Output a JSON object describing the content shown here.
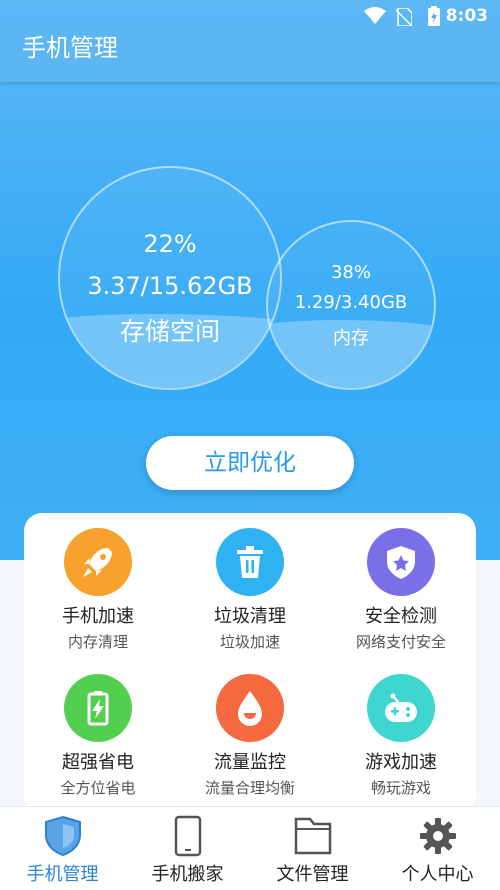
{
  "status": {
    "time": "8:03"
  },
  "app": {
    "title": "手机管理"
  },
  "storage": {
    "percent": "22%",
    "usage": "3.37/15.62GB",
    "label": "存储空间"
  },
  "memory": {
    "percent": "38%",
    "usage": "1.29/3.40GB",
    "label": "内存"
  },
  "optimize": {
    "label": "立即优化"
  },
  "tiles": [
    {
      "title": "手机加速",
      "sub": "内存清理",
      "icon": "rocket-icon",
      "color": "#f7a22c"
    },
    {
      "title": "垃圾清理",
      "sub": "垃圾加速",
      "icon": "trash-icon",
      "color": "#2fb2f2"
    },
    {
      "title": "安全检测",
      "sub": "网络支付安全",
      "icon": "shield-star-icon",
      "color": "#7b6fe8"
    },
    {
      "title": "超强省电",
      "sub": "全方位省电",
      "icon": "battery-icon",
      "color": "#52cf4f"
    },
    {
      "title": "流量监控",
      "sub": "流量合理均衡",
      "icon": "drop-icon",
      "color": "#f5693e"
    },
    {
      "title": "游戏加速",
      "sub": "畅玩游戏",
      "icon": "gamepad-icon",
      "color": "#3ed6cf"
    }
  ],
  "nav": [
    {
      "label": "手机管理",
      "icon": "shield-icon",
      "active": true
    },
    {
      "label": "手机搬家",
      "icon": "phone-icon",
      "active": false
    },
    {
      "label": "文件管理",
      "icon": "folder-icon",
      "active": false
    },
    {
      "label": "个人中心",
      "icon": "gear-icon",
      "active": false
    }
  ],
  "colors": {
    "primary": "#33a9f6",
    "nav_active": "#2a83d9"
  }
}
